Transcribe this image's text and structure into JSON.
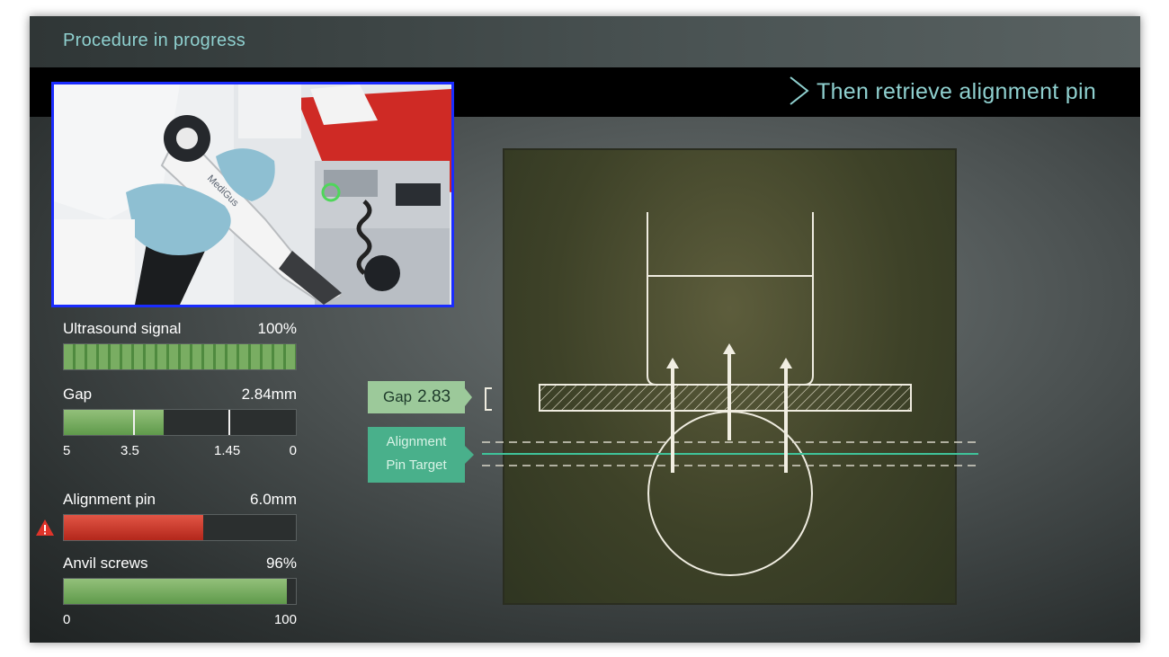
{
  "header": {
    "title": "Procedure in progress"
  },
  "step": {
    "text": "Then retrieve alignment pin"
  },
  "video": {
    "device_brand": "MediGus"
  },
  "gauges": {
    "ultrasound": {
      "label": "Ultrasound signal",
      "value": "100%",
      "level": 1.0
    },
    "gap": {
      "label": "Gap",
      "value": "2.84mm",
      "scale": [
        "5",
        "3.5",
        "1.45",
        "0"
      ],
      "level": 0.43
    },
    "alignment_pin": {
      "label": "Alignment pin",
      "value": "6.0mm",
      "level": 0.6
    },
    "anvil_screws": {
      "label": "Anvil screws",
      "value": "96%",
      "scale_min": "0",
      "scale_max": "100",
      "level": 0.96
    }
  },
  "diagram": {
    "gap_tag": {
      "label": "Gap",
      "value": "2.83"
    },
    "pin_tag": {
      "line1": "Alignment",
      "line2": "Pin Target"
    }
  },
  "colors": {
    "accent_text": "#8fd0cf",
    "video_border": "#1a2cff",
    "gauge_green": "#5f9a4b",
    "gauge_red": "#b3271b",
    "target_line": "#3fc39a"
  }
}
